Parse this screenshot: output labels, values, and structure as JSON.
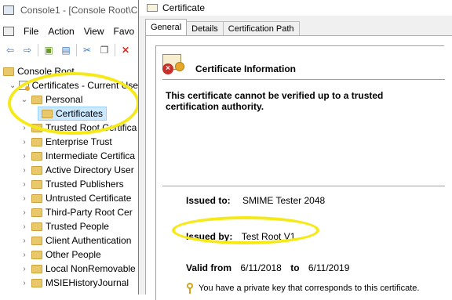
{
  "console": {
    "title": "Console1 - [Console Root\\C",
    "menu": [
      "File",
      "Action",
      "View",
      "Favo"
    ],
    "tree": {
      "root": "Console Root",
      "store": "Certificates - Current Use",
      "personal": "Personal",
      "certificates": "Certificates",
      "folders": [
        "Trusted Root Certifica",
        "Enterprise Trust",
        "Intermediate Certifica",
        "Active Directory User",
        "Trusted Publishers",
        "Untrusted Certificate",
        "Third-Party Root Cer",
        "Trusted People",
        "Client Authentication",
        "Other People",
        "Local NonRemovable",
        "MSIEHistoryJournal"
      ]
    }
  },
  "dialog": {
    "title": "Certificate",
    "tabs": [
      "General",
      "Details",
      "Certification Path"
    ],
    "active_tab": "General",
    "info_title": "Certificate Information",
    "warning": "This certificate cannot be verified up to a trusted certification authority.",
    "issued_to_label": "Issued to:",
    "issued_to": "SMIME Tester 2048",
    "issued_by_label": "Issued by:",
    "issued_by": "Test Root V1",
    "valid_from_label": "Valid from",
    "valid_from": "6/11/2018",
    "to_label": "to",
    "valid_to": "6/11/2019",
    "private_key_note": "You have a private key that corresponds to this certificate."
  },
  "colors": {
    "highlight_ellipse": "#f5ea18",
    "selection": "#cce8ff",
    "folder": "#e8c86a"
  }
}
